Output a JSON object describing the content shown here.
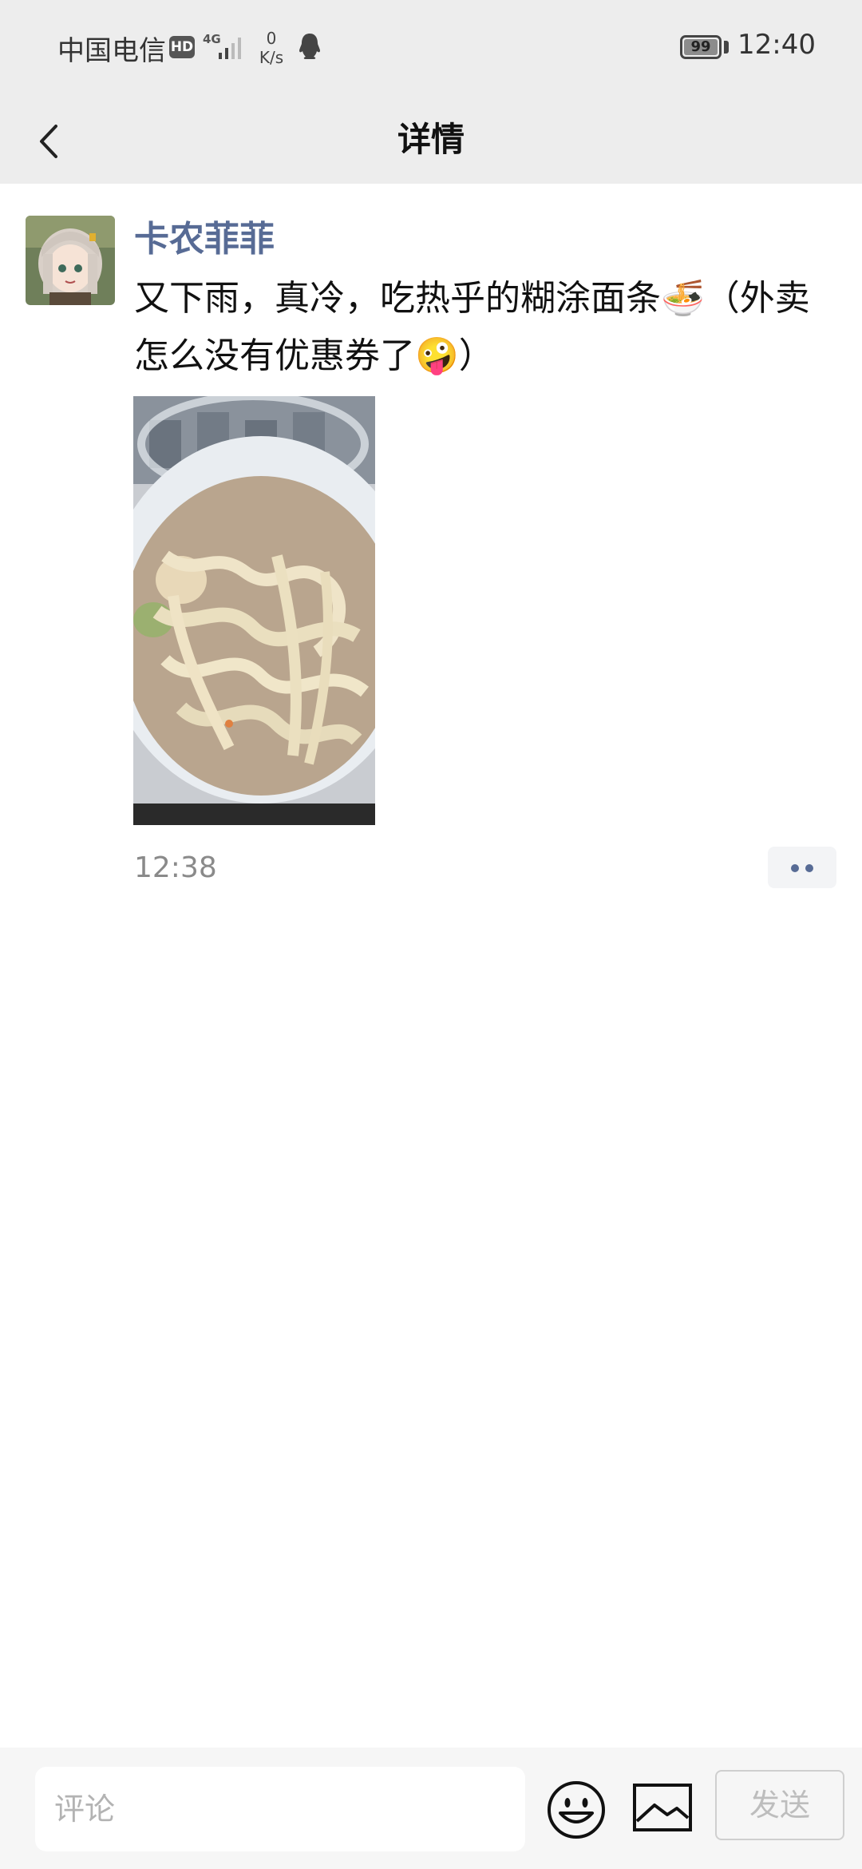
{
  "status_bar": {
    "carrier": "中国电信",
    "hd_badge": "HD",
    "network": "4G",
    "speed_value": "0",
    "speed_unit": "K/s",
    "battery": "99",
    "time": "12:40",
    "icons": [
      "signal-bars-icon",
      "qq-icon",
      "battery-icon"
    ]
  },
  "nav": {
    "title": "详情",
    "back_icon": "chevron-left-icon"
  },
  "post": {
    "author": "卡农菲菲",
    "text": "又下雨，真冷，吃热乎的糊涂面条🍜（外卖怎么没有优惠券了🤪）",
    "image_description_icon": "food-photo",
    "time": "12:38",
    "more_icon": "two-dots-icon"
  },
  "comment_bar": {
    "placeholder": "评论",
    "emoji_icon": "smiley-icon",
    "image_icon": "image-icon",
    "send_label": "发送"
  },
  "colors": {
    "bar_background": "#ededed",
    "author_link": "#576b95",
    "timestamp": "#8a8a8a",
    "send_disabled": "#bdbdbd"
  }
}
